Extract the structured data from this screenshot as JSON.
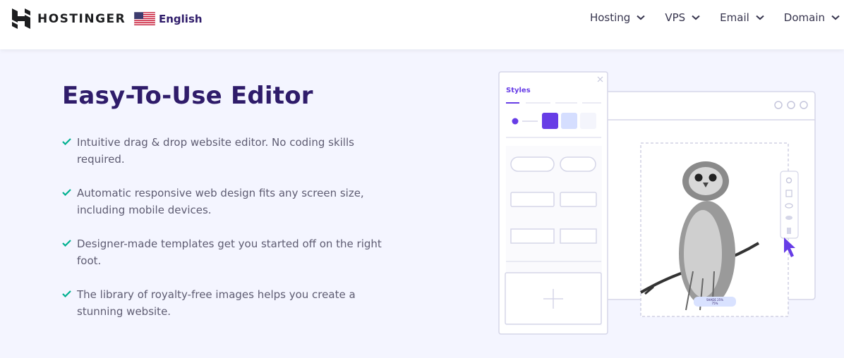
{
  "header": {
    "brand": "HOSTINGER",
    "language": "English",
    "nav": [
      {
        "label": "Hosting"
      },
      {
        "label": "VPS"
      },
      {
        "label": "Email"
      },
      {
        "label": "Domain"
      }
    ]
  },
  "main": {
    "title": "Easy-To-Use Editor",
    "features": [
      "Intuitive drag & drop website editor. No coding skills required.",
      "Automatic responsive web design fits any screen size, including mobile devices.",
      "Designer-made templates get you started off on the right foot.",
      "The library of royalty-free images helps you create a stunning website."
    ]
  },
  "illustration": {
    "panel_title": "Styles",
    "image_caption_line1": "SHADE 25%",
    "image_caption_line2": "75%"
  },
  "colors": {
    "brand_purple": "#673de6",
    "heading": "#2f1c6a",
    "check_green": "#00b090",
    "background": "#f4f5ff"
  }
}
